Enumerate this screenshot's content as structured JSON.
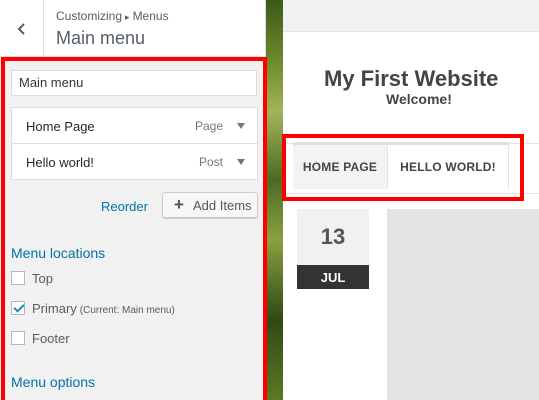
{
  "customizer": {
    "breadcrumb_root": "Customizing",
    "breadcrumb_separator": "▸",
    "breadcrumb_section": "Menus",
    "panel_title": "Main menu",
    "menu_name_value": "Main menu",
    "menu_items": [
      {
        "title": "Home Page",
        "type": "Page"
      },
      {
        "title": "Hello world!",
        "type": "Post"
      }
    ],
    "reorder_label": "Reorder",
    "add_items_label": "Add Items",
    "locations_heading": "Menu locations",
    "locations": [
      {
        "label": "Top",
        "checked": false,
        "note": ""
      },
      {
        "label": "Primary",
        "checked": true,
        "note": "(Current: Main menu)"
      },
      {
        "label": "Footer",
        "checked": false,
        "note": ""
      }
    ],
    "options_heading": "Menu options"
  },
  "preview": {
    "site_title": "My First Website",
    "site_description": "Welcome!",
    "nav": [
      "HOME PAGE",
      "HELLO WORLD!"
    ],
    "post_date": {
      "day": "13",
      "month": "JUL"
    }
  },
  "colors": {
    "highlight": "#ff0000",
    "link": "#0073aa",
    "checkbox_check": "#1e8cbe"
  },
  "icons": {
    "back": "chevron-left-icon",
    "add": "plus-icon",
    "item_toggle": "caret-down-icon"
  }
}
